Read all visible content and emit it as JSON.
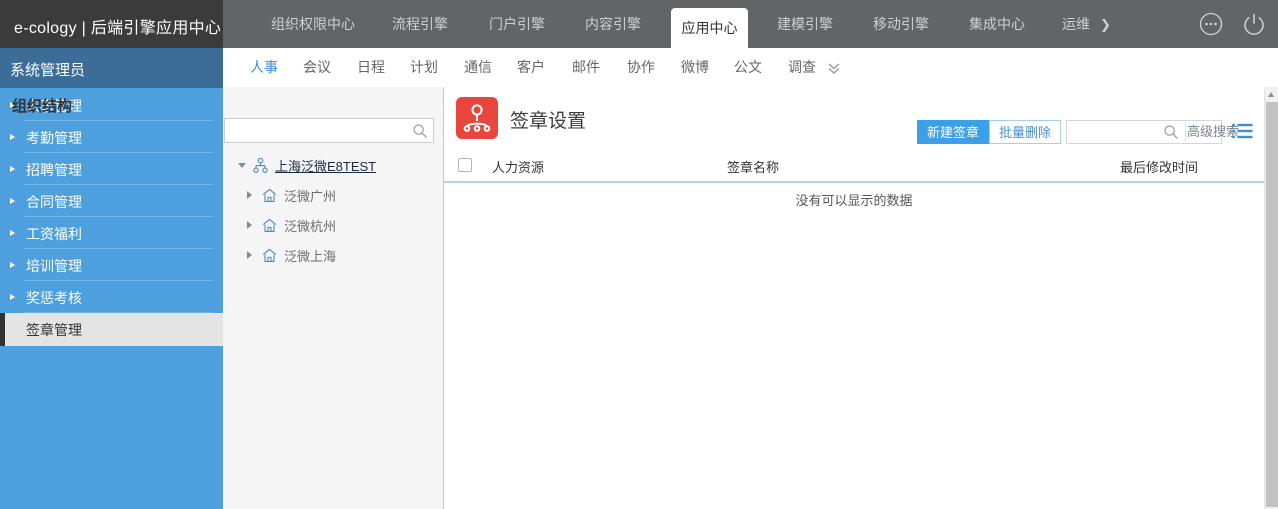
{
  "topbar": {
    "brand": "e-cology | 后端引擎应用中心",
    "nav": [
      {
        "label": "组织权限中心"
      },
      {
        "label": "流程引擎"
      },
      {
        "label": "门户引擎"
      },
      {
        "label": "内容引擎"
      },
      {
        "label": "应用中心"
      },
      {
        "label": "建模引擎"
      },
      {
        "label": "移动引擎"
      },
      {
        "label": "集成中心"
      },
      {
        "label": "运维"
      }
    ],
    "active_nav": "应用中心",
    "overflow_chevron": "❯",
    "more_icon": "more-circle-icon",
    "power_icon": "power-icon"
  },
  "subnav": {
    "tabs": [
      {
        "label": "人事"
      },
      {
        "label": "会议"
      },
      {
        "label": "日程"
      },
      {
        "label": "计划"
      },
      {
        "label": "通信"
      },
      {
        "label": "客户"
      },
      {
        "label": "邮件"
      },
      {
        "label": "协作"
      },
      {
        "label": "微博"
      },
      {
        "label": "公文"
      },
      {
        "label": "调查"
      }
    ],
    "active_tab": "人事",
    "expand_icon": "chevron-double-down-icon"
  },
  "sidebar": {
    "title": "系统管理员",
    "items": [
      {
        "label": "人事管理"
      },
      {
        "label": "考勤管理"
      },
      {
        "label": "招聘管理"
      },
      {
        "label": "合同管理"
      },
      {
        "label": "工资福利"
      },
      {
        "label": "培训管理"
      },
      {
        "label": "奖惩考核"
      },
      {
        "label": "签章管理"
      }
    ],
    "active_item": "签章管理"
  },
  "org_panel": {
    "title": "组织结构",
    "search": {
      "value": "",
      "placeholder": "",
      "icon": "search-icon"
    },
    "tree": [
      {
        "label": "上海泛微E8TEST",
        "icon": "org-chart-icon",
        "expanded": true,
        "level": 0
      },
      {
        "label": "泛微广州",
        "icon": "home-icon",
        "expanded": false,
        "level": 1
      },
      {
        "label": "泛微杭州",
        "icon": "home-icon",
        "expanded": false,
        "level": 1
      },
      {
        "label": "泛微上海",
        "icon": "home-icon",
        "expanded": false,
        "level": 1
      }
    ],
    "collapse_icon": "chevron-left-icon"
  },
  "content": {
    "icon": "seal-hierarchy-icon",
    "title": "签章设置",
    "toolbar": {
      "new_label": "新建签章",
      "batch_delete_label": "批量删除",
      "search_value": "",
      "search_placeholder": "",
      "search_icon": "search-icon",
      "advanced_search_label": "高级搜索",
      "list_view_icon": "list-view-icon"
    },
    "table": {
      "columns": [
        "人力资源",
        "签章名称",
        "最后修改时间"
      ],
      "rows": [],
      "empty_text": "没有可以显示的数据",
      "select_all_checked": false
    }
  },
  "colors": {
    "brand_bar": "#3b3b3b",
    "top_nav_bg": "#636466",
    "sidebar_bg": "#4da0dd",
    "sidebar_header_bg": "#3b6d98",
    "accent_blue": "#3ba0e8",
    "link_blue": "#3b8fd4",
    "seal_red": "#e8453c",
    "table_rule": "#a9d5f0"
  }
}
